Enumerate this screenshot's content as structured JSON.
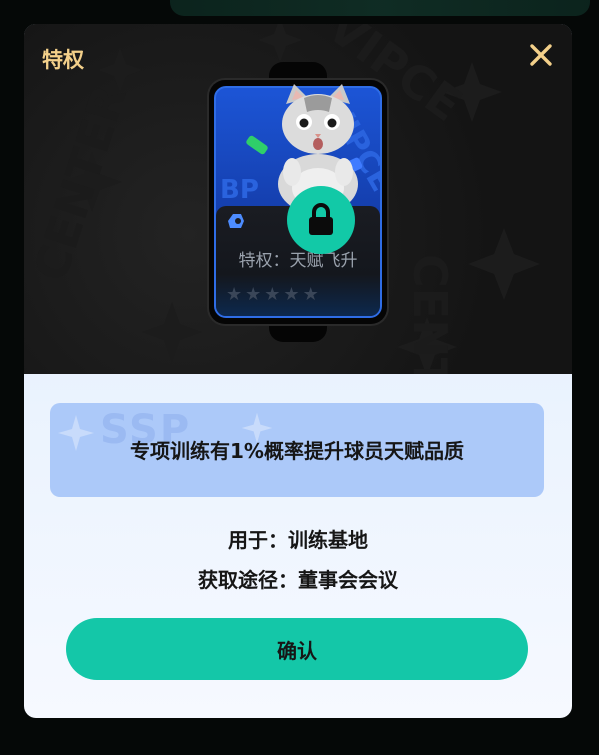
{
  "dialog": {
    "title": "特权",
    "close_icon": "close-icon",
    "accent_color": "#14c7a8",
    "title_color": "#f3d08a"
  },
  "card": {
    "name": "特权：天赋飞升",
    "stars_total": 5,
    "stars_filled": 0,
    "locked": true,
    "lock_icon": "lock-icon",
    "mascot": "cat",
    "background_watermark": "VIPCENTER",
    "watermark_on_card": "ВР"
  },
  "description": {
    "text": "专项训练有1%概率提升球员天赋品质",
    "watermark": "SSP"
  },
  "info": {
    "usage_label": "用于：训练基地",
    "source_label": "获取途径：董事会会议"
  },
  "actions": {
    "confirm_label": "确认"
  }
}
